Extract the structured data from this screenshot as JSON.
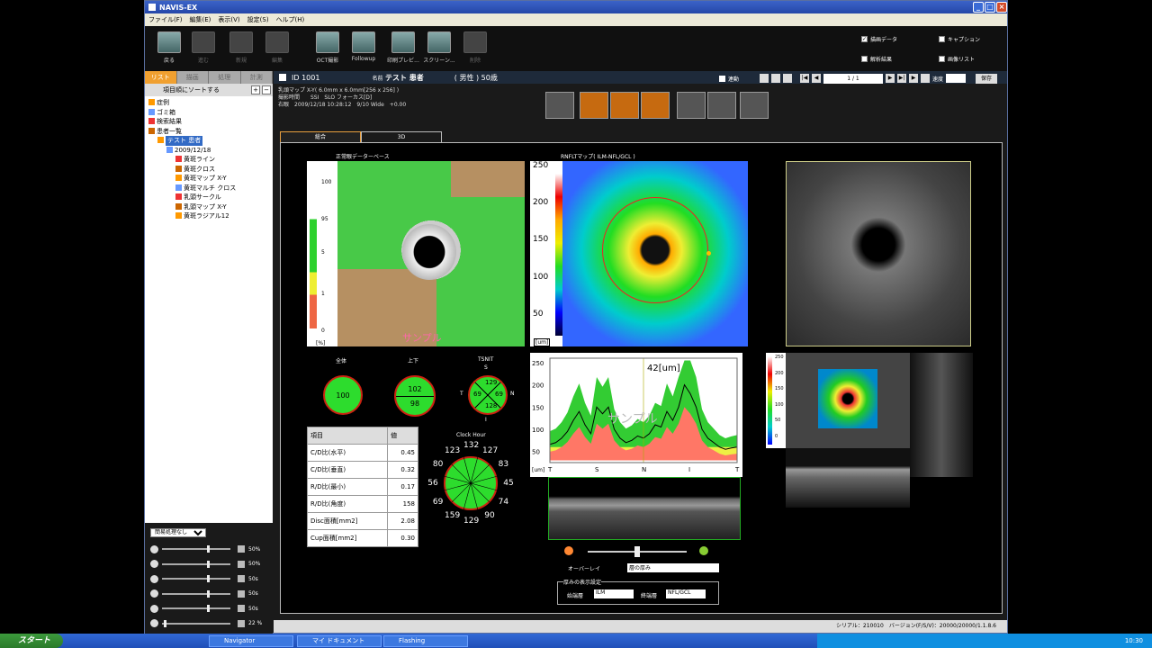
{
  "window": {
    "title": "NAVIS-EX"
  },
  "menu": [
    "ファイル(F)",
    "編集(E)",
    "表示(V)",
    "設定(S)",
    "ヘルプ(H)"
  ],
  "toolbar": [
    "戻る",
    "進む",
    "新規",
    "編集",
    "OCT撮影",
    "Followup",
    "印刷プレビ...",
    "スクリーン...",
    "削除"
  ],
  "toolbar_checks": [
    {
      "label": "描画データ",
      "checked": true
    },
    {
      "label": "キャプション",
      "checked": false
    },
    {
      "label": "解析結果",
      "checked": false
    },
    {
      "label": "画像リスト",
      "checked": false
    }
  ],
  "left_tabs": [
    "リスト",
    "描画",
    "処理",
    "計測"
  ],
  "sort_label": "項目順にソートする",
  "tree": [
    {
      "label": "症例",
      "indent": 1
    },
    {
      "label": "ゴミ箱",
      "indent": 1
    },
    {
      "label": "検索結果",
      "indent": 1
    },
    {
      "label": "患者一覧",
      "indent": 1
    },
    {
      "label": "テスト 患者",
      "indent": 2,
      "selected": true
    },
    {
      "label": "2009/12/18",
      "indent": 3
    },
    {
      "label": "黄斑ライン",
      "indent": 4
    },
    {
      "label": "黄斑クロス",
      "indent": 4
    },
    {
      "label": "黄斑マップ X-Y",
      "indent": 4
    },
    {
      "label": "黄斑マルチ クロス",
      "indent": 4
    },
    {
      "label": "乳頭サークル",
      "indent": 4
    },
    {
      "label": "乳頭マップ X-Y",
      "indent": 4
    },
    {
      "label": "黄斑ラジアル12",
      "indent": 4
    }
  ],
  "adjust": {
    "preset": "簡易処理なし",
    "rows": [
      "50%",
      "50%",
      "50s",
      "50s",
      "50s",
      "22 %"
    ]
  },
  "header": {
    "id_label": "ID",
    "id": "1001",
    "name_label": "名前",
    "name": "テスト 患者",
    "sex_age": "( 男性 ) 50歳",
    "link_label": "連動",
    "page": "1 / 1",
    "speed_label": "速度",
    "save": "保存"
  },
  "scan_info": [
    "乳頭マップ X-Y( 6.0mm x 6.0mm[256 x 256] )",
    "撮影時間　　SSI　SLO フォーカス[D]",
    "右眼　2009/12/18 10:28:12　9/10 Wide　+0.00"
  ],
  "tabs": [
    "総合",
    "3D"
  ],
  "normative": {
    "title": "正常眼データーベース",
    "ticks": [
      "100",
      "95",
      "5",
      "1",
      "0"
    ],
    "unit": "[%]",
    "watermark": "サンプル"
  },
  "rnfl": {
    "title": "RNFLTマップ( ILM-NFL/GCL )",
    "ticks": [
      "250",
      "200",
      "150",
      "100",
      "50"
    ],
    "unit": "[um]"
  },
  "sectors": {
    "total_label": "全体",
    "total": "100",
    "ud_label": "上下",
    "upper": "102",
    "lower": "98",
    "tsnit_label": "TSNIT",
    "s": "S",
    "t": "T",
    "n": "N",
    "i": "I",
    "ts": "129",
    "tt": "69",
    "tn": "69",
    "ti": "128"
  },
  "clock": {
    "title": "Clock Hour",
    "values": [
      "132",
      "127",
      "83",
      "45",
      "74",
      "90",
      "129",
      "159",
      "69",
      "56",
      "80",
      "123"
    ]
  },
  "table": {
    "h1": "項目",
    "h2": "値",
    "rows": [
      [
        "C/D比(水平)",
        "0.45"
      ],
      [
        "C/D比(垂直)",
        "0.32"
      ],
      [
        "R/D比(最小)",
        "0.17"
      ],
      [
        "R/D比(角度)",
        "158"
      ],
      [
        "Disc面積[mm2]",
        "2.08"
      ],
      [
        "Cup面積[mm2]",
        "0.30"
      ]
    ]
  },
  "chart_data": {
    "type": "line",
    "ylabel": "",
    "xlabel": "",
    "unit_label": "[um]",
    "x_ticks": [
      "T",
      "S",
      "N",
      "I",
      "T"
    ],
    "y_ticks": [
      "250",
      "200",
      "150",
      "100",
      "50"
    ],
    "ylim": [
      25,
      260
    ],
    "cursor_label": "42[um]",
    "watermark": "サンプル",
    "series": [
      {
        "values": [
          66,
          70,
          80,
          95,
          120,
          140,
          110,
          90,
          150,
          135,
          150,
          100,
          80,
          70,
          75,
          85,
          80,
          90,
          110,
          105,
          140,
          120,
          150,
          200,
          180,
          150,
          100,
          80,
          70,
          60,
          55,
          58,
          60
        ]
      }
    ]
  },
  "overlay": {
    "label": "オーバーレイ",
    "value": "層の厚み"
  },
  "thickness": {
    "title": "厚みの表示設定",
    "start_label": "始端層",
    "start": "ILM",
    "end_label": "終端層",
    "end": "NFL/GCL"
  },
  "small_scale": [
    "250",
    "200",
    "150",
    "100",
    "50",
    "0"
  ],
  "status": "シリアル：210010　バージョン(F/S/V)：20000/20000/1.1.8.6",
  "taskbar": {
    "start": "スタート",
    "tasks": [
      "Navigator",
      "マイ ドキュメント",
      "Flashing"
    ],
    "clock": "10:30"
  }
}
